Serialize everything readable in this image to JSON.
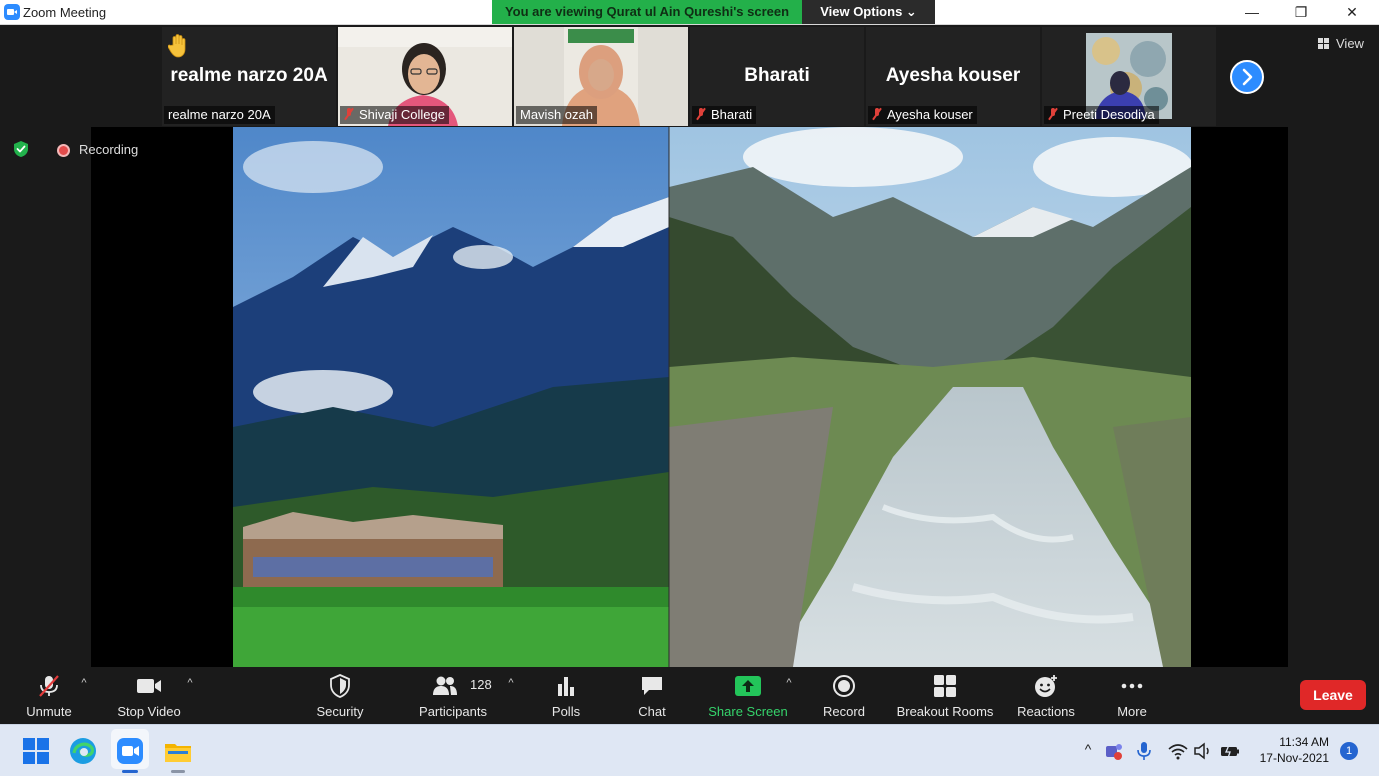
{
  "window": {
    "title": "Zoom Meeting",
    "banner": "You are viewing Qurat ul Ain Qureshi's screen",
    "view_options": "View Options ⌄",
    "minimize": "—",
    "maximize": "❐",
    "close": "✕"
  },
  "participants_strip": [
    {
      "big_name": "realme narzo 20A",
      "label": "realme narzo 20A",
      "muted": false,
      "hand_raised": true
    },
    {
      "big_name": "",
      "label": "Shivaji College",
      "muted": true
    },
    {
      "big_name": "",
      "label": "Mavish ozah",
      "muted": false,
      "active": true
    },
    {
      "big_name": "Bharati",
      "label": "Bharati",
      "muted": true
    },
    {
      "big_name": "Ayesha kouser",
      "label": "Ayesha kouser",
      "muted": true
    },
    {
      "big_name": "",
      "label": "Preeti Desodiya",
      "muted": true
    }
  ],
  "view_button": "View",
  "recording": {
    "label": "Recording"
  },
  "toolbar": {
    "unmute": "Unmute",
    "stop_video": "Stop Video",
    "security": "Security",
    "participants": "Participants",
    "participants_count": "128",
    "polls": "Polls",
    "chat": "Chat",
    "share_screen": "Share Screen",
    "record": "Record",
    "breakout_rooms": "Breakout Rooms",
    "reactions": "Reactions",
    "more": "More",
    "leave": "Leave",
    "caret": "^"
  },
  "taskbar": {
    "time": "11:34 AM",
    "date": "17-Nov-2021",
    "notifications": "1",
    "tray_chevron": "^"
  },
  "colors": {
    "banner_green": "#23b04a",
    "share_green": "#35d36b",
    "leave_red": "#e02828",
    "zoom_blue": "#2d8cff",
    "active_outline": "#a5d64a"
  }
}
